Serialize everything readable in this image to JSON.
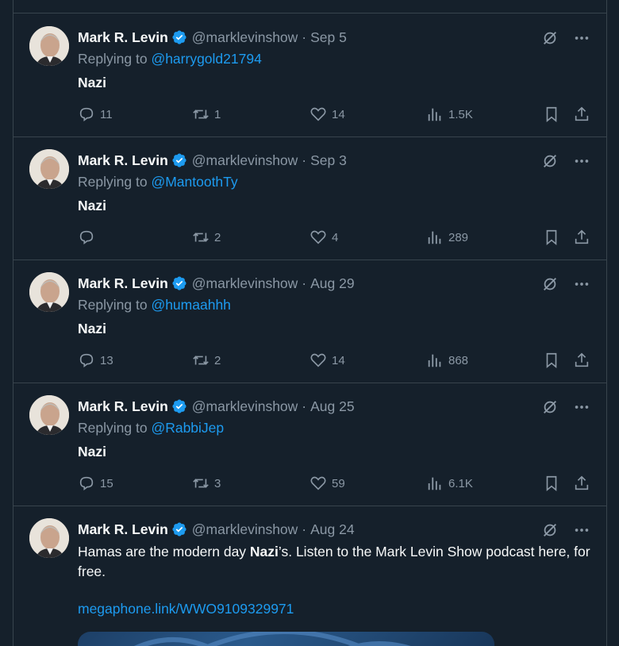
{
  "tweets": [
    {
      "name": "Mark R. Levin",
      "handle": "@marklevinshow",
      "date": "Sep 5",
      "replying_prefix": "Replying to",
      "replying_to": "@harrygold21794",
      "text": "Nazi",
      "replies": "11",
      "retweets": "1",
      "likes": "14",
      "views": "1.5K"
    },
    {
      "name": "Mark R. Levin",
      "handle": "@marklevinshow",
      "date": "Sep 3",
      "replying_prefix": "Replying to",
      "replying_to": "@MantoothTy",
      "text": "Nazi",
      "replies": "",
      "retweets": "2",
      "likes": "4",
      "views": "289"
    },
    {
      "name": "Mark R. Levin",
      "handle": "@marklevinshow",
      "date": "Aug 29",
      "replying_prefix": "Replying to",
      "replying_to": "@humaahhh",
      "text": "Nazi",
      "replies": "13",
      "retweets": "2",
      "likes": "14",
      "views": "868"
    },
    {
      "name": "Mark R. Levin",
      "handle": "@marklevinshow",
      "date": "Aug 25",
      "replying_prefix": "Replying to",
      "replying_to": "@RabbiJep",
      "text": "Nazi",
      "replies": "15",
      "retweets": "3",
      "likes": "59",
      "views": "6.1K"
    }
  ],
  "last_tweet": {
    "name": "Mark R. Levin",
    "handle": "@marklevinshow",
    "date": "Aug 24",
    "text_before": "Hamas are the modern day ",
    "text_bold": "Nazi",
    "text_after": "’s. Listen to the Mark Levin Show podcast here, for free.",
    "link": "megaphone.link/WWO9109329971"
  },
  "colors": {
    "background": "#15202b",
    "border": "#38444d",
    "secondary_text": "#8b98a5",
    "accent": "#1d9bf0"
  },
  "icons": [
    "verified-badge-icon",
    "grok-icon",
    "more-icon",
    "reply-icon",
    "retweet-icon",
    "like-icon",
    "views-icon",
    "bookmark-icon",
    "share-icon"
  ]
}
